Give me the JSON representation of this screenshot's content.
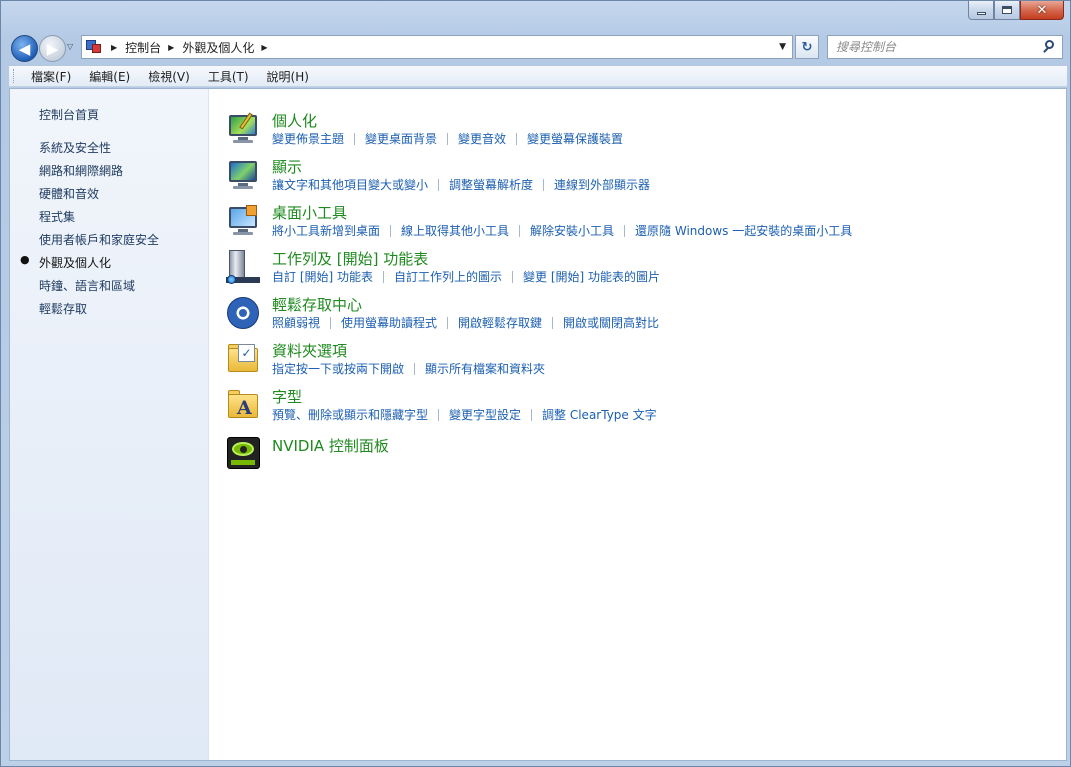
{
  "window": {
    "caption_buttons": {
      "minimize_icon": "minimize-icon",
      "maximize_icon": "maximize-icon",
      "close_glyph": "✕"
    }
  },
  "address_bar": {
    "breadcrumbs": [
      "控制台",
      "外觀及個人化"
    ],
    "search_placeholder": "搜尋控制台"
  },
  "menu": [
    "檔案(F)",
    "編輯(E)",
    "檢視(V)",
    "工具(T)",
    "說明(H)"
  ],
  "sidebar": {
    "home": "控制台首頁",
    "items": [
      "系統及安全性",
      "網路和網際網路",
      "硬體和音效",
      "程式集",
      "使用者帳戶和家庭安全",
      "外觀及個人化",
      "時鐘、語言和區域",
      "輕鬆存取"
    ],
    "active_index": 5
  },
  "categories": [
    {
      "title": "個人化",
      "icon": "personalization-icon",
      "links": [
        "變更佈景主題",
        "變更桌面背景",
        "變更音效",
        "變更螢幕保護裝置"
      ]
    },
    {
      "title": "顯示",
      "icon": "display-icon",
      "links": [
        "讓文字和其他項目變大或變小",
        "調整螢幕解析度",
        "連線到外部顯示器"
      ]
    },
    {
      "title": "桌面小工具",
      "icon": "desktop-gadgets-icon",
      "links": [
        "將小工具新增到桌面",
        "線上取得其他小工具",
        "解除安裝小工具",
        "還原隨 Windows 一起安裝的桌面小工具"
      ]
    },
    {
      "title": "工作列及 [開始] 功能表",
      "icon": "taskbar-icon",
      "links": [
        "自訂 [開始] 功能表",
        "自訂工作列上的圖示",
        "變更 [開始] 功能表的圖片"
      ]
    },
    {
      "title": "輕鬆存取中心",
      "icon": "ease-of-access-icon",
      "links": [
        "照顧弱視",
        "使用螢幕助讀程式",
        "開啟輕鬆存取鍵",
        "開啟或關閉高對比"
      ]
    },
    {
      "title": "資料夾選項",
      "icon": "folder-options-icon",
      "links": [
        "指定按一下或按兩下開啟",
        "顯示所有檔案和資料夾"
      ]
    },
    {
      "title": "字型",
      "icon": "fonts-icon",
      "links": [
        "預覽、刪除或顯示和隱藏字型",
        "變更字型設定",
        "調整 ClearType 文字"
      ]
    },
    {
      "title": "NVIDIA 控制面板",
      "icon": "nvidia-icon",
      "links": []
    }
  ]
}
